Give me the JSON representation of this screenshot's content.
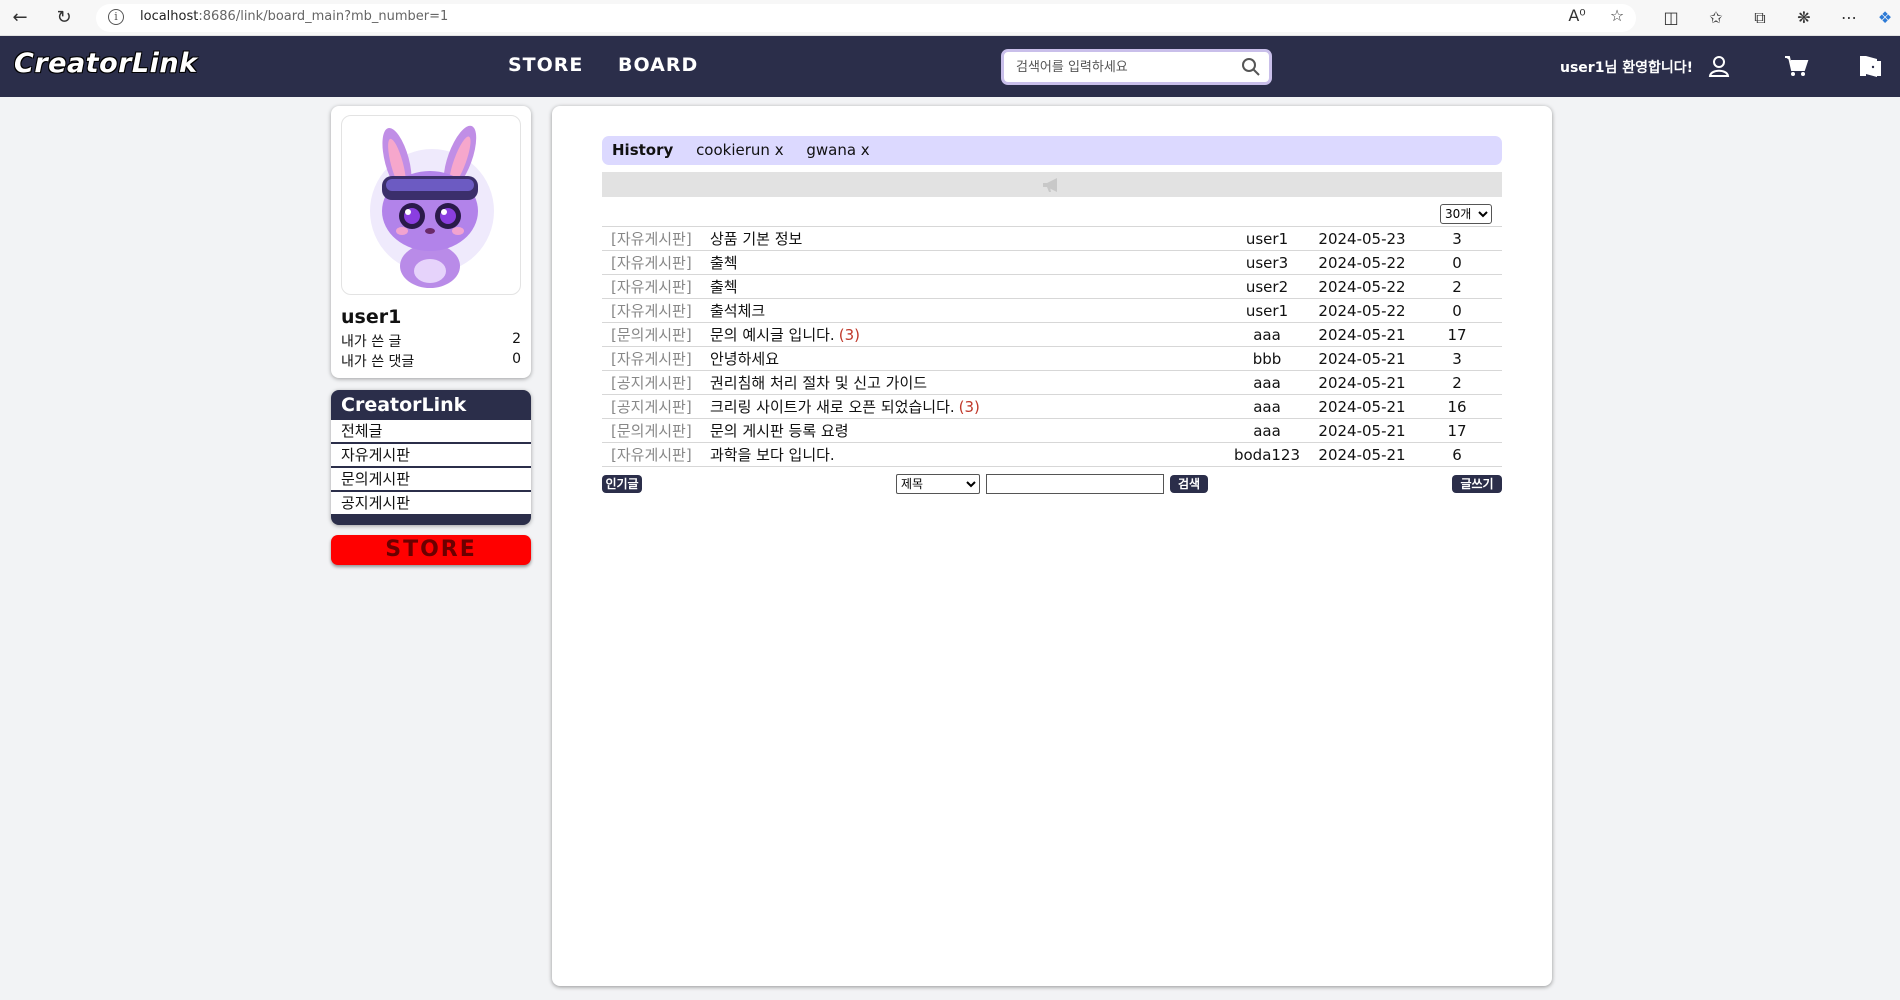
{
  "browser": {
    "url_host": "localhost",
    "url_rest": ":8686/link/board_main?mb_number=1"
  },
  "header": {
    "logo": "CreatorLink",
    "nav": [
      "STORE",
      "BOARD"
    ],
    "search_placeholder": "검색어를 입력하세요",
    "welcome": "user1님 환영합니다!"
  },
  "profile": {
    "username": "user1",
    "stats": [
      {
        "label": "내가 쓴 글",
        "value": "2"
      },
      {
        "label": "내가 쓴 댓글",
        "value": "0"
      }
    ]
  },
  "menu": {
    "title": "CreatorLink",
    "items": [
      "전체글",
      "자유게시판",
      "문의게시판",
      "공지게시판"
    ]
  },
  "store_button": "STORE",
  "history": {
    "label": "History",
    "chips": [
      "cookierun x",
      "gwana x"
    ]
  },
  "per_page": {
    "selected": "30개"
  },
  "posts": [
    {
      "category": "[자유게시판]",
      "title": "상품 기본 정보",
      "comments": "",
      "writer": "user1",
      "date": "2024-05-23",
      "views": "3"
    },
    {
      "category": "[자유게시판]",
      "title": "출첵",
      "comments": "",
      "writer": "user3",
      "date": "2024-05-22",
      "views": "0"
    },
    {
      "category": "[자유게시판]",
      "title": "출첵",
      "comments": "",
      "writer": "user2",
      "date": "2024-05-22",
      "views": "2"
    },
    {
      "category": "[자유게시판]",
      "title": "출석체크",
      "comments": "",
      "writer": "user1",
      "date": "2024-05-22",
      "views": "0"
    },
    {
      "category": "[문의게시판]",
      "title": "문의 예시글 입니다.",
      "comments": "(3)",
      "writer": "aaa",
      "date": "2024-05-21",
      "views": "17"
    },
    {
      "category": "[자유게시판]",
      "title": "안녕하세요",
      "comments": "",
      "writer": "bbb",
      "date": "2024-05-21",
      "views": "3"
    },
    {
      "category": "[공지게시판]",
      "title": "권리침해 처리 절차 및 신고 가이드",
      "comments": "",
      "writer": "aaa",
      "date": "2024-05-21",
      "views": "2"
    },
    {
      "category": "[공지게시판]",
      "title": "크리링 사이트가 새로 오픈 되었습니다.",
      "comments": "(3)",
      "writer": "aaa",
      "date": "2024-05-21",
      "views": "16"
    },
    {
      "category": "[문의게시판]",
      "title": "문의 게시판 등록 요령",
      "comments": "",
      "writer": "aaa",
      "date": "2024-05-21",
      "views": "17"
    },
    {
      "category": "[자유게시판]",
      "title": "과학을 보다 입니다.",
      "comments": "",
      "writer": "boda123",
      "date": "2024-05-21",
      "views": "6"
    }
  ],
  "bottom": {
    "popular_button": "인기글",
    "search_type_selected": "제목",
    "search_button": "검색",
    "write_button": "글쓰기"
  },
  "colors": {
    "header_bg": "#2b2e4a",
    "history_bg": "#dcd9ff",
    "store_red": "#ff0000",
    "comment_count": "#c0392b"
  }
}
